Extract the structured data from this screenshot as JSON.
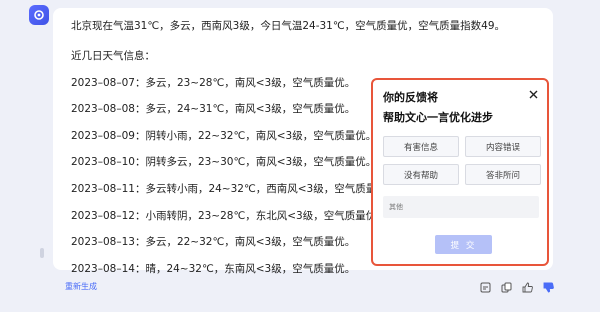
{
  "message": {
    "current": "北京现在气温31℃，多云，西南风3级，今日气温24-31℃，空气质量优，空气质量指数49。",
    "heading": "近几日天气信息：",
    "days": [
      "2023–08–07：多云，23~28℃，南风<3级，空气质量优。",
      "2023–08–08：多云，24~31℃，南风<3级，空气质量优。",
      "2023–08–09：阴转小雨，22~32℃，南风<3级，空气质量优。",
      "2023–08–10：阴转多云，23~30℃，南风<3级，空气质量优。",
      "2023–08–11：多云转小雨，24~32℃，西南风<3级，空气质量优。",
      "2023–08–12：小雨转阴，23~28℃，东北风<3级，空气质量优。",
      "2023–08–13：多云，22~32℃，南风<3级，空气质量优。",
      "2023–08–14：晴，24~32℃，东南风<3级，空气质量优。"
    ]
  },
  "footer": {
    "regenerate": "重新生成"
  },
  "feedback": {
    "title_line1": "你的反馈将",
    "title_line2": "帮助文心一言优化进步",
    "options": [
      "有害信息",
      "内容错误",
      "没有帮助",
      "答非所问"
    ],
    "other_placeholder": "其他",
    "submit": "提 交"
  },
  "icons": {
    "avatar": "ernie-bot-logo-icon",
    "close": "close-icon",
    "footer": [
      "copy-icon",
      "share-icon",
      "thumbs-up-icon",
      "thumbs-down-icon"
    ]
  },
  "colors": {
    "accent": "#4a6cf7",
    "highlight_border": "#e8553a",
    "submit_disabled": "#b5c1f8"
  }
}
